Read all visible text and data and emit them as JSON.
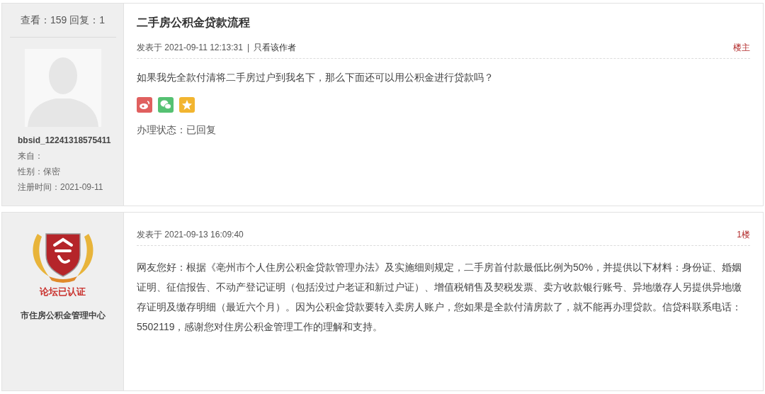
{
  "posts": [
    {
      "kind": "topic",
      "author": {
        "stats": "查看：159 回复：1",
        "avatar": {
          "kind": "silhouette"
        },
        "name": "bbsid_12241318575411",
        "fields": [
          "来自：",
          "性别：保密",
          "注册时间：2021-09-11"
        ]
      },
      "title": "二手房公积金贷款流程",
      "posted": "发表于 2021-09-11 12:13:31",
      "separator": "|",
      "author_only_link": "只看该作者",
      "floor": "楼主",
      "body": "如果我先全款付清将二手房过户到我名下，那么下面还可以用公积金进行贷款吗？",
      "share_icons": [
        {
          "kind": "weibo"
        },
        {
          "kind": "wechat"
        },
        {
          "kind": "qzone"
        }
      ],
      "status": "办理状态：已回复"
    },
    {
      "kind": "reply",
      "author": {
        "avatar": {
          "kind": "badge"
        },
        "badge_caption": "论坛已认证",
        "name": "市住房公积金管理中心"
      },
      "posted": "发表于 2021-09-13 16:09:40",
      "floor": "1楼",
      "body": "网友您好：根据《亳州市个人住房公积金贷款管理办法》及实施细则规定，二手房首付款最低比例为50%，并提供以下材料：身份证、婚姻证明、征信报告、不动产登记证明（包括没过户老证和新过户证）、增值税销售及契税发票、卖方收款银行账号、异地缴存人另提供异地缴存证明及缴存明细（最近六个月）。因为公积金贷款要转入卖房人账户，您如果是全款付清房款了，就不能再办理贷款。信贷科联系电话：5502119，感谢您对住房公积金管理工作的理解和支持。"
    }
  ]
}
